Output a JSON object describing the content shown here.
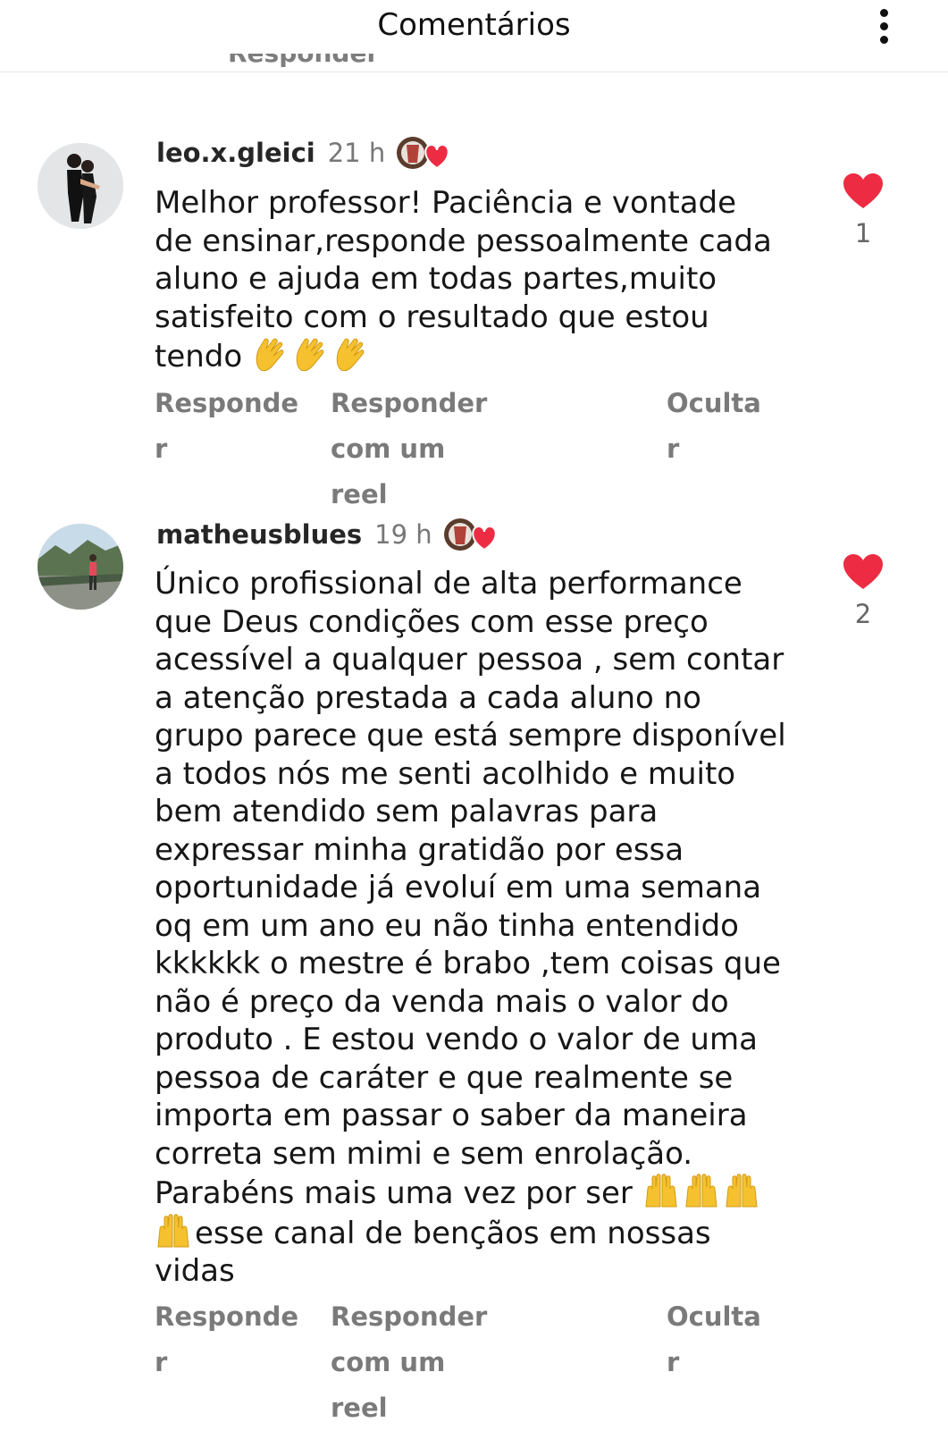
{
  "header": {
    "title": "Comentários"
  },
  "clipped_action": "Responder",
  "comments": [
    {
      "username": "leo.x.gleici",
      "time": "21 h",
      "lines": [
        "Melhor professor! Paciência e vontade",
        "de ensinar,responde pessoalmente cada",
        "aluno e ajuda em todas partes,muito",
        "satisfeito com o resultado que estou",
        "tendo "
      ],
      "like_count": "1",
      "actions": {
        "reply_a": "Responde",
        "reply_b": "r",
        "reel_a": "Responder com um",
        "reel_b": "reel",
        "hide_a": "Oculta",
        "hide_b": "r"
      }
    },
    {
      "username": "matheusblues",
      "time": "19 h",
      "lines": [
        "Único profissional de alta performance",
        "que Deus condições com esse preço",
        "acessível a qualquer pessoa , sem contar",
        "a atenção prestada a cada aluno no",
        "grupo parece que está sempre disponível",
        "a todos nós  me senti acolhido e muito",
        "bem atendido sem palavras para",
        "expressar minha gratidão por essa",
        "oportunidade já evoluí em uma semana",
        "oq em um ano eu não tinha entendido",
        "kkkkkk o mestre é brabo ,tem coisas que",
        "não é preço da venda mais o valor do",
        "produto .  E estou vendo o valor de uma",
        "pessoa de caráter e que realmente se",
        "importa em passar o saber da maneira",
        "correta sem mimi e sem enrolação.",
        "Parabéns mais uma vez por  ser ",
        "esse canal de bençãos em nossas",
        "vidas"
      ],
      "like_count": "2",
      "actions": {
        "reply_a": "Responde",
        "reply_b": "r",
        "reel_a": "Responder com um",
        "reel_b": "reel",
        "hide_a": "Oculta",
        "hide_b": "r"
      }
    }
  ],
  "colors": {
    "heart": "#ed2c43",
    "action_gray": "#7a7a7a",
    "clap_yellow": "#f6c12f"
  },
  "icons": [
    "more-options-icon",
    "clapping-hands-emoji",
    "raising-hands-emoji",
    "heart-icon",
    "creator-liked-badge"
  ]
}
